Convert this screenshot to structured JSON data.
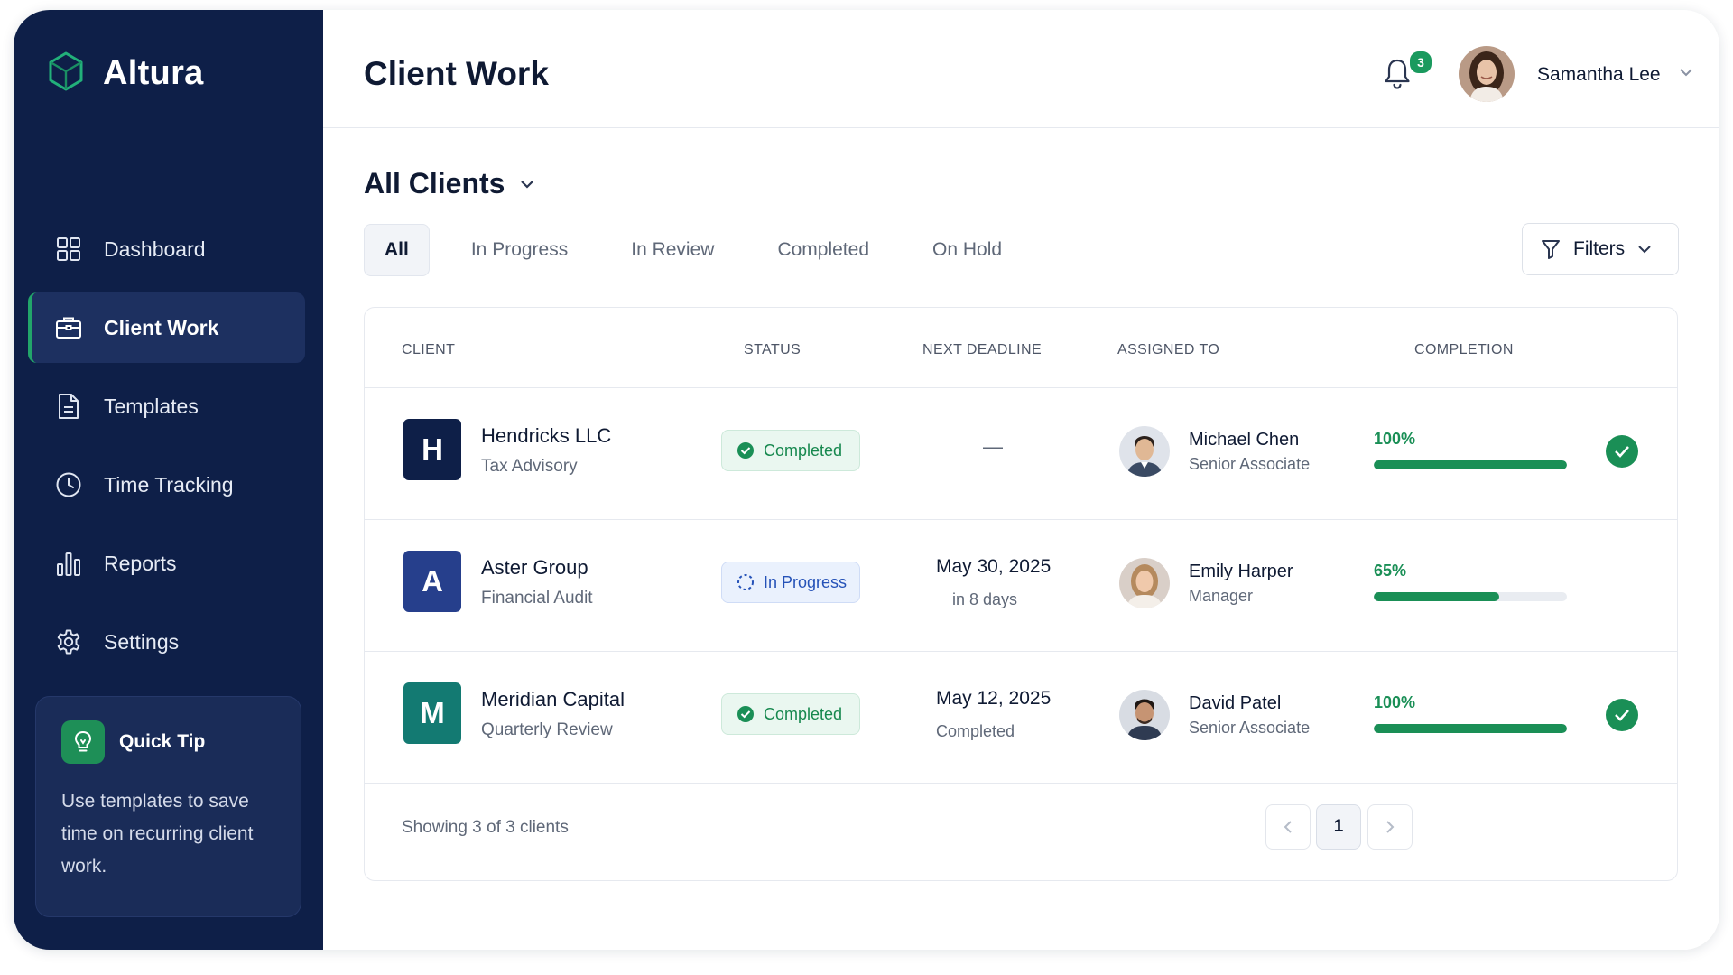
{
  "app": {
    "name": "Altura"
  },
  "sidebar": {
    "items": [
      {
        "label": "Dashboard",
        "icon": "dashboard-icon"
      },
      {
        "label": "Client Work",
        "icon": "briefcase-icon",
        "active": true
      },
      {
        "label": "Templates",
        "icon": "document-icon"
      },
      {
        "label": "Time Tracking",
        "icon": "clock-icon"
      },
      {
        "label": "Reports",
        "icon": "bar-chart-icon"
      },
      {
        "label": "Settings",
        "icon": "gear-icon"
      }
    ],
    "tip": {
      "title": "Quick Tip",
      "text": "Use templates to save time on recurring client work.",
      "icon": "lightbulb-icon"
    }
  },
  "header": {
    "title": "Client Work",
    "notification_count": "3",
    "user_name": "Samantha Lee"
  },
  "section": {
    "title": "All Clients"
  },
  "tabs": [
    "All",
    "In Progress",
    "In Review",
    "Completed",
    "On Hold"
  ],
  "filters_label": "Filters",
  "table": {
    "columns": {
      "client": "CLIENT",
      "status": "STATUS",
      "deadline": "NEXT DEADLINE",
      "assigned": "ASSIGNED TO",
      "completion": "COMPLETION"
    },
    "rows": [
      {
        "initial": "H",
        "logo_color": "#0e1f48",
        "name": "Hendricks LLC",
        "service": "Tax Advisory",
        "status": "Completed",
        "status_type": "done",
        "deadline": "—",
        "deadline_sub": "",
        "assignee": "Michael Chen",
        "role": "Senior Associate",
        "completion_label": "100%",
        "completion": 1.0
      },
      {
        "initial": "A",
        "logo_color": "#263f8c",
        "name": "Aster Group",
        "service": "Financial Audit",
        "status": "In Progress",
        "status_type": "prog",
        "deadline": "May 30, 2025",
        "deadline_sub": "in 8 days",
        "assignee": "Emily Harper",
        "role": "Manager",
        "completion_label": "65%",
        "completion": 0.65
      },
      {
        "initial": "M",
        "logo_color": "#137a72",
        "name": "Meridian Capital",
        "service": "Quarterly Review",
        "status": "Completed",
        "status_type": "done",
        "deadline": "May 12, 2025",
        "deadline_sub": "Completed",
        "assignee": "David Patel",
        "role": "Senior Associate",
        "completion_label": "100%",
        "completion": 1.0
      }
    ]
  },
  "footer": {
    "showing": "Showing 3 of 3 clients",
    "page": "1"
  },
  "colors": {
    "sidebar": "#0e1f48",
    "accent_green": "#1a8f56",
    "progress_blue": "#2552b8"
  }
}
